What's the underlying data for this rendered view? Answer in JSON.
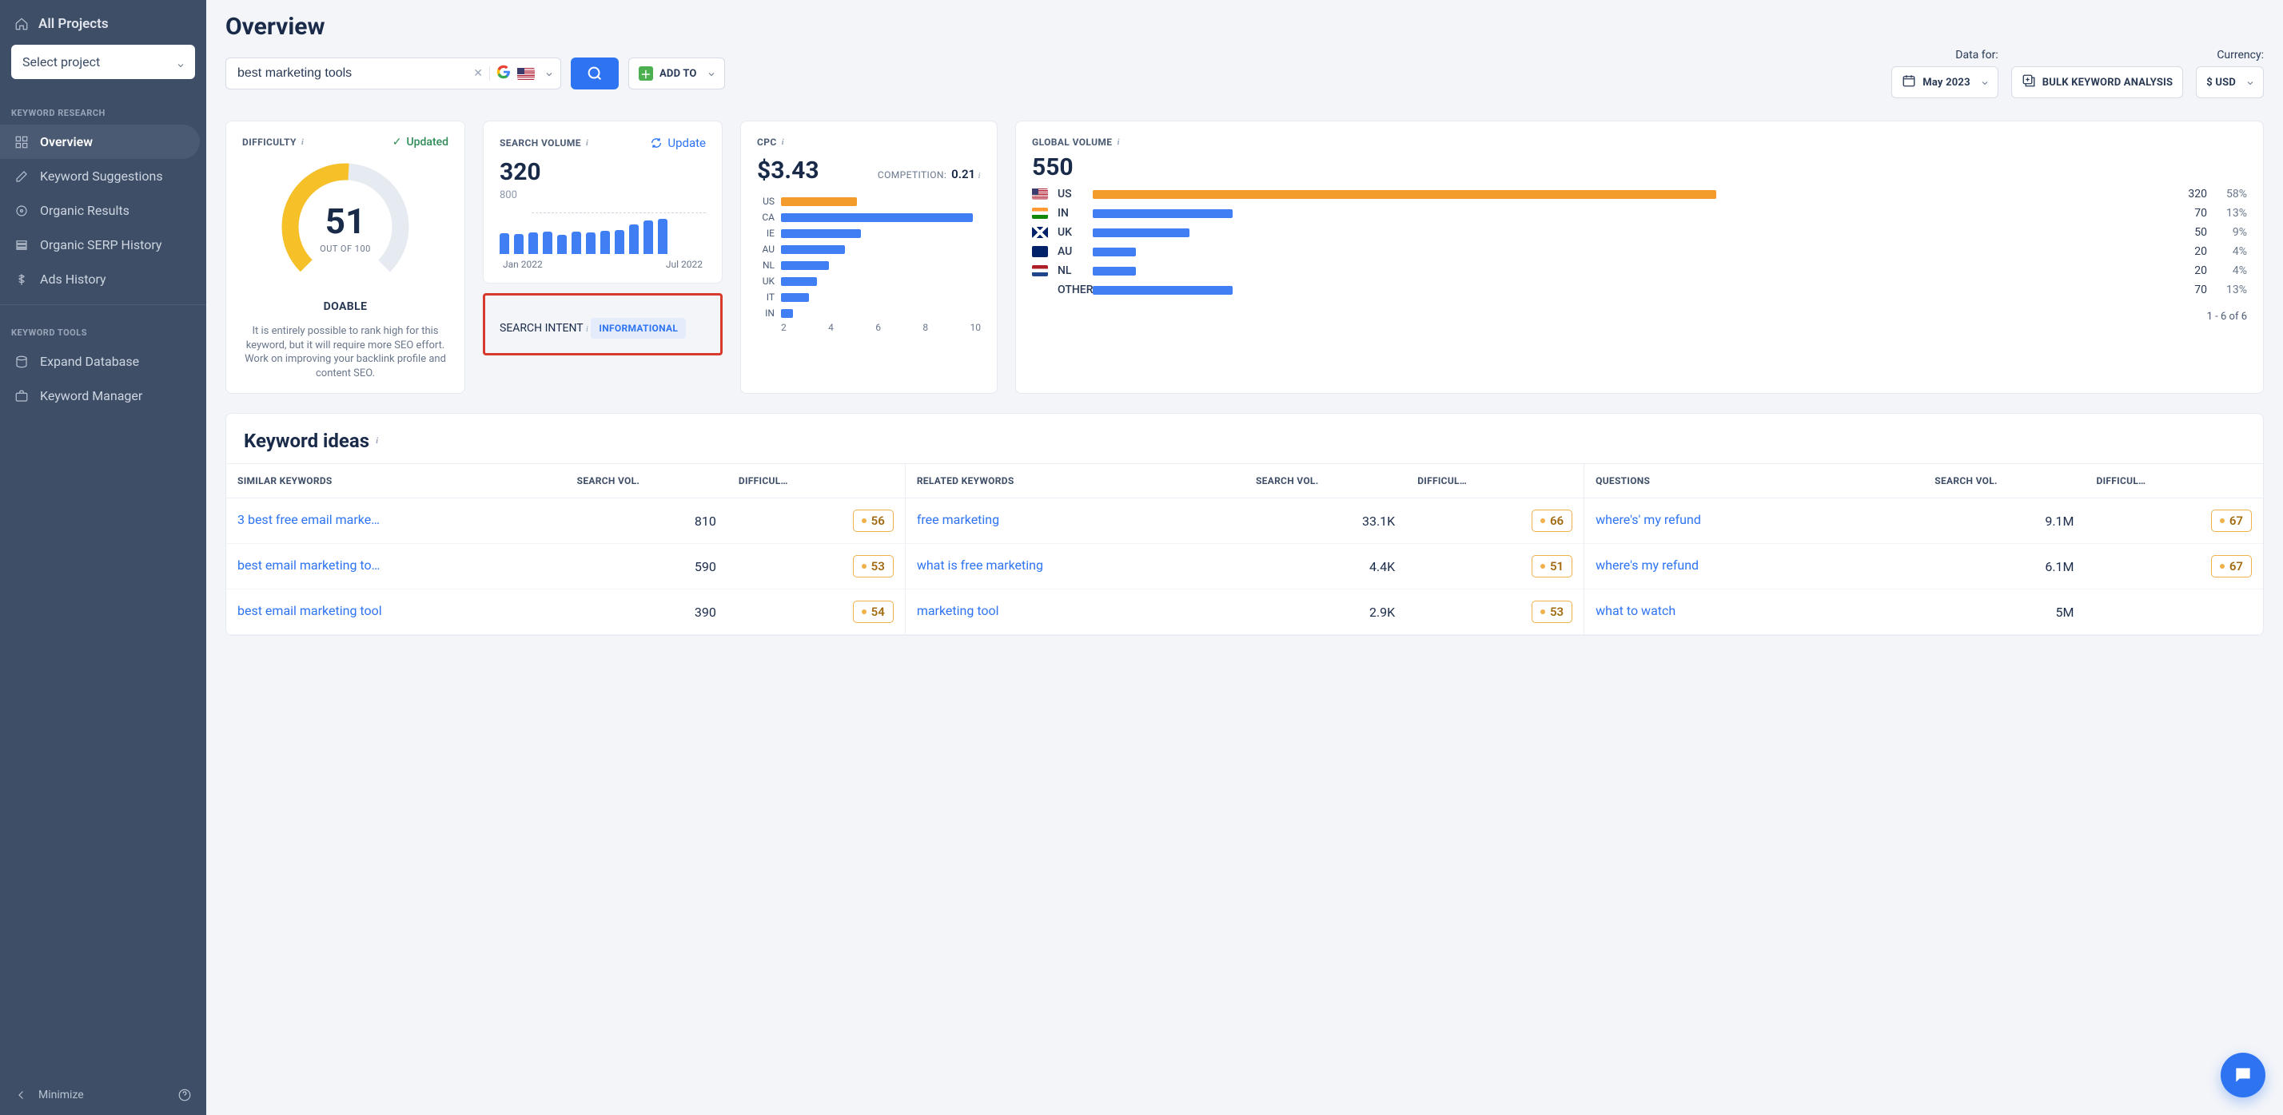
{
  "sidebar": {
    "all_projects": "All Projects",
    "select_project_placeholder": "Select project",
    "section_research": "KEYWORD RESEARCH",
    "items_research": [
      {
        "label": "Overview"
      },
      {
        "label": "Keyword Suggestions"
      },
      {
        "label": "Organic Results"
      },
      {
        "label": "Organic SERP History"
      },
      {
        "label": "Ads History"
      }
    ],
    "section_tools": "KEYWORD TOOLS",
    "items_tools": [
      {
        "label": "Expand Database"
      },
      {
        "label": "Keyword Manager"
      }
    ],
    "minimize": "Minimize"
  },
  "header": {
    "title": "Overview",
    "search_value": "best marketing tools",
    "add_to_label": "ADD TO",
    "data_for_label": "Data for:",
    "date_label": "May 2023",
    "bulk_label": "BULK KEYWORD ANALYSIS",
    "currency_label": "Currency:",
    "currency_value": "$ USD"
  },
  "difficulty": {
    "title": "DIFFICULTY",
    "status": "Updated",
    "value": "51",
    "of_label": "OUT OF 100",
    "verdict": "DOABLE",
    "desc": "It is entirely possible to rank high for this keyword, but it will require more SEO effort. Work on improving your backlink profile and content SEO."
  },
  "volume": {
    "title": "SEARCH VOLUME",
    "update_label": "Update",
    "value": "320",
    "max": "800",
    "xlabel_left": "Jan 2022",
    "xlabel_right": "Jul 2022"
  },
  "intent": {
    "title": "SEARCH INTENT",
    "value": "INFORMATIONAL"
  },
  "cpc": {
    "title": "CPC",
    "value": "$3.43",
    "competition_label": "COMPETITION:",
    "competition_value": "0.21",
    "rows": [
      {
        "code": "US",
        "w": 38,
        "orange": true
      },
      {
        "code": "CA",
        "w": 96,
        "orange": false
      },
      {
        "code": "IE",
        "w": 40,
        "orange": false
      },
      {
        "code": "AU",
        "w": 32,
        "orange": false
      },
      {
        "code": "NL",
        "w": 24,
        "orange": false
      },
      {
        "code": "UK",
        "w": 18,
        "orange": false
      },
      {
        "code": "IT",
        "w": 14,
        "orange": false
      },
      {
        "code": "IN",
        "w": 6,
        "orange": false
      }
    ],
    "xticks": [
      "2",
      "4",
      "6",
      "8",
      "10"
    ]
  },
  "global": {
    "title": "GLOBAL VOLUME",
    "value": "550",
    "rows": [
      {
        "code": "US",
        "flag": "fl-us",
        "n": "320",
        "pct": "58%",
        "w": 58,
        "orange": true
      },
      {
        "code": "IN",
        "flag": "fl-in",
        "n": "70",
        "pct": "13%",
        "w": 13,
        "orange": false
      },
      {
        "code": "UK",
        "flag": "fl-uk",
        "n": "50",
        "pct": "9%",
        "w": 9,
        "orange": false
      },
      {
        "code": "AU",
        "flag": "fl-au",
        "n": "20",
        "pct": "4%",
        "w": 4,
        "orange": false
      },
      {
        "code": "NL",
        "flag": "fl-nl",
        "n": "20",
        "pct": "4%",
        "w": 4,
        "orange": false
      },
      {
        "code": "OTHER",
        "flag": "",
        "n": "70",
        "pct": "13%",
        "w": 13,
        "orange": false
      }
    ],
    "footer": "1 - 6 of 6"
  },
  "ideas": {
    "title": "Keyword ideas",
    "cols": {
      "similar": "SIMILAR KEYWORDS",
      "vol": "SEARCH VOL.",
      "diff": "DIFFICUL…",
      "related": "RELATED KEYWORDS",
      "questions": "QUESTIONS"
    },
    "similar": [
      {
        "kw": "3 best free email marke…",
        "vol": "810",
        "diff": "56"
      },
      {
        "kw": "best email marketing to…",
        "vol": "590",
        "diff": "53"
      },
      {
        "kw": "best email marketing tool",
        "vol": "390",
        "diff": "54"
      }
    ],
    "related": [
      {
        "kw": "free marketing",
        "vol": "33.1K",
        "diff": "66"
      },
      {
        "kw": "what is free marketing",
        "vol": "4.4K",
        "diff": "51"
      },
      {
        "kw": "marketing tool",
        "vol": "2.9K",
        "diff": "53"
      }
    ],
    "questions": [
      {
        "kw": "where's' my refund",
        "vol": "9.1M",
        "diff": "67"
      },
      {
        "kw": "where's my refund",
        "vol": "6.1M",
        "diff": "67"
      },
      {
        "kw": "what to watch",
        "vol": "5M",
        "diff": ""
      }
    ]
  },
  "chart_data": {
    "volume_bars": {
      "type": "bar",
      "values": [
        26,
        25,
        27,
        28,
        24,
        28,
        27,
        29,
        30,
        37,
        42,
        44
      ],
      "ymax": 56
    },
    "cpc_hbar": {
      "type": "bar",
      "categories": [
        "US",
        "CA",
        "IE",
        "AU",
        "NL",
        "UK",
        "IT",
        "IN"
      ],
      "values": [
        3.8,
        9.6,
        4.0,
        3.2,
        2.4,
        1.8,
        1.4,
        0.6
      ],
      "xlim": [
        0,
        10
      ]
    },
    "global_volume": {
      "type": "bar",
      "categories": [
        "US",
        "IN",
        "UK",
        "AU",
        "NL",
        "OTHER"
      ],
      "values": [
        320,
        70,
        50,
        20,
        20,
        70
      ]
    }
  }
}
